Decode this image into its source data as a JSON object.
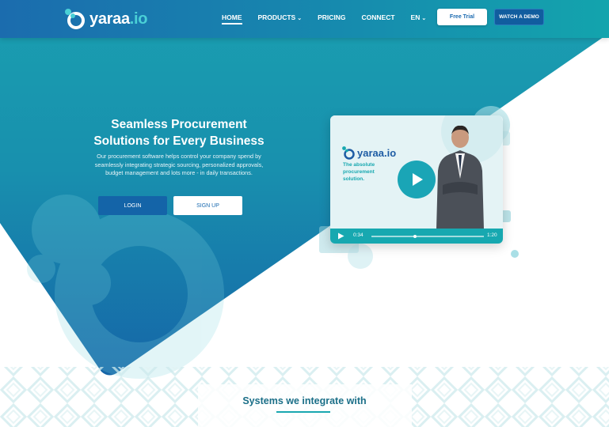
{
  "nav": {
    "logo_text": "yaraa",
    "logo_suffix": ".io",
    "links": [
      {
        "label": "HOME"
      },
      {
        "label": "PRODUCTS"
      },
      {
        "label": "PRICING"
      },
      {
        "label": "CONNECT"
      },
      {
        "label": "EN"
      }
    ],
    "free_trial": "Free Trial",
    "watch_demo": "WATCH A DEMO"
  },
  "hero": {
    "title_line1": "Seamless Procurement",
    "title_line2": "Solutions for Every Business",
    "description": "Our procurement software helps control your company spend by seamlessly integrating strategic sourcing, personalized approvals, budget management and lots more - in daily transactions.",
    "login": "LOGIN",
    "signup": "SIGN UP"
  },
  "video": {
    "logo_text": "yaraa.io",
    "tagline_line1": "The absolute",
    "tagline_line2": "procurement",
    "tagline_line3": "solution.",
    "current_time": "0:34",
    "duration": "1:20",
    "progress": 0.39
  },
  "systems": {
    "title": "Systems we integrate with"
  },
  "colors": {
    "primary_blue": "#1464a8",
    "teal": "#17a8b0",
    "heading_teal": "#1b6f88"
  }
}
